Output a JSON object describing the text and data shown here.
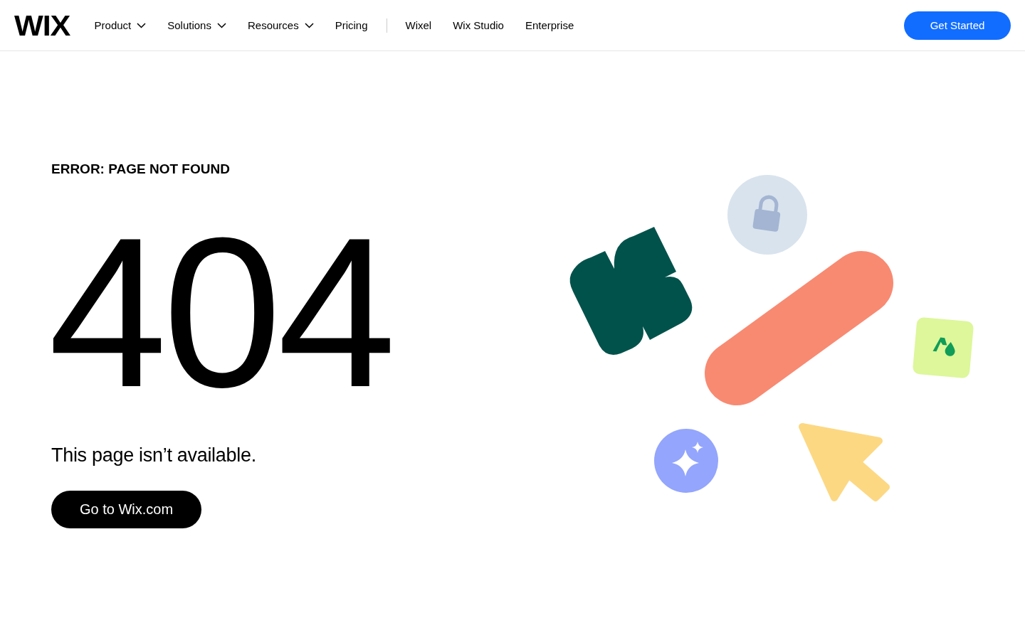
{
  "logo": "WIX",
  "nav": {
    "primary": [
      {
        "label": "Product",
        "has_menu": true
      },
      {
        "label": "Solutions",
        "has_menu": true
      },
      {
        "label": "Resources",
        "has_menu": true
      },
      {
        "label": "Pricing",
        "has_menu": false
      }
    ],
    "secondary": [
      "Wixel",
      "Wix Studio",
      "Enterprise"
    ]
  },
  "cta": "Get Started",
  "error": {
    "label": "ERROR: PAGE NOT FOUND",
    "code": "404",
    "message": "This page isn’t available.",
    "button": "Go to Wix.com"
  }
}
